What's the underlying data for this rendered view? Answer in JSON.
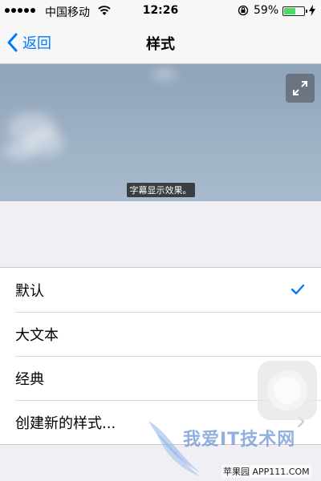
{
  "status_bar": {
    "carrier": "中国移动",
    "time": "12:26",
    "battery_percent": "59%",
    "battery_level": 0.59
  },
  "nav": {
    "back_label": "返回",
    "title": "样式"
  },
  "preview": {
    "subtitle_text": "字幕显示效果。"
  },
  "styles": {
    "items": [
      {
        "label": "默认",
        "selected": true
      },
      {
        "label": "大文本",
        "selected": false
      },
      {
        "label": "经典",
        "selected": false
      },
      {
        "label": "创建新的样式...",
        "selected": false
      }
    ]
  },
  "watermark": {
    "title": "我爱IT技术网",
    "subtitle": "苹果园  APP111.COM"
  },
  "colors": {
    "accent": "#007aff",
    "battery": "#4cd964"
  },
  "icons": [
    "signal-icon",
    "wifi-icon",
    "rotation-lock-icon",
    "battery-icon",
    "charging-icon",
    "back-chevron-icon",
    "fullscreen-icon",
    "checkmark-icon",
    "disclosure-chevron-icon"
  ]
}
